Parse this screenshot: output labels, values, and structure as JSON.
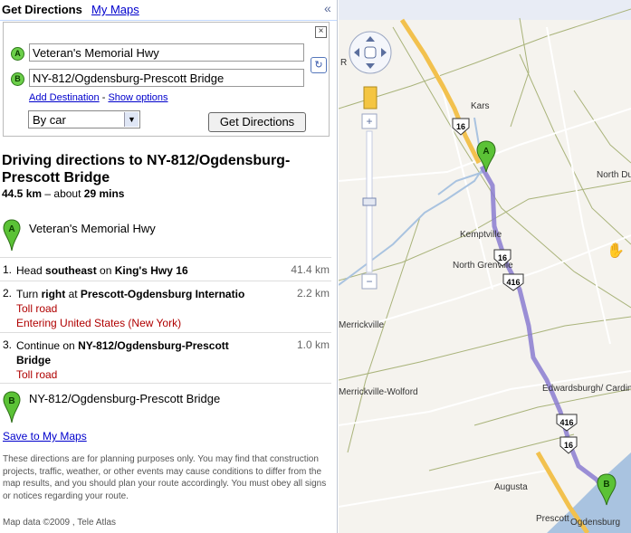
{
  "tabs": {
    "active": "Get Directions",
    "other": "My Maps",
    "collapse": "«"
  },
  "form": {
    "from_marker": "A",
    "from_value": "Veteran's Memorial Hwy",
    "to_marker": "B",
    "to_value": "NY-812/Ogdensburg-Prescott Bridge",
    "add_destination": "Add Destination",
    "separator": "-",
    "show_options": "Show options",
    "mode": "By car",
    "submit": "Get Directions"
  },
  "directions": {
    "title": "Driving directions to NY-812/Ogdensburg-Prescott Bridge",
    "distance": "44.5 km",
    "dash": "– about",
    "time": "29 mins",
    "start": "Veteran's Memorial Hwy",
    "end": "NY-812/Ogdensburg-Prescott Bridge",
    "steps": [
      {
        "num": "1.",
        "pre": "Head ",
        "b1": "southeast",
        "mid": " on ",
        "b2": "King's Hwy 16",
        "notes": [],
        "dist": "41.4 km"
      },
      {
        "num": "2.",
        "pre": "Turn ",
        "b1": "right",
        "mid": " at ",
        "b2": "Prescott-Ogdensburg Internatio",
        "notes": [
          "Toll road",
          "Entering United States (New York)"
        ],
        "dist": "2.2 km"
      },
      {
        "num": "3.",
        "pre": "Continue on ",
        "b1": "NY-812/Ogdensburg-Prescott Bridge",
        "mid": "",
        "b2": "",
        "notes": [
          "Toll road"
        ],
        "dist": "1.0 km"
      }
    ],
    "save": "Save to My Maps",
    "disclaimer": "These directions are for planning purposes only. You may find that construction projects, traffic, weather, or other events may cause conditions to differ from the map results, and you should plan your route accordingly. You must obey all signs or notices regarding your route.",
    "map_data": "Map data ©2009 , Tele Atlas"
  },
  "map": {
    "labels": [
      "Kars",
      "North Dundas",
      "Kemptville",
      "North Grenville",
      "Merrickville",
      "Merrickville-Wolford",
      "Edwardsburgh/ Cardinal",
      "Augusta",
      "Prescott",
      "Ogdensburg",
      "R"
    ],
    "shields": [
      "16",
      "16",
      "416",
      "416",
      "16"
    ],
    "markers": [
      "A",
      "B"
    ],
    "colors": {
      "route": "#8a7bd0",
      "highway": "#f2c14e",
      "water": "#a9c3e0",
      "marker": "#5bc236"
    }
  }
}
